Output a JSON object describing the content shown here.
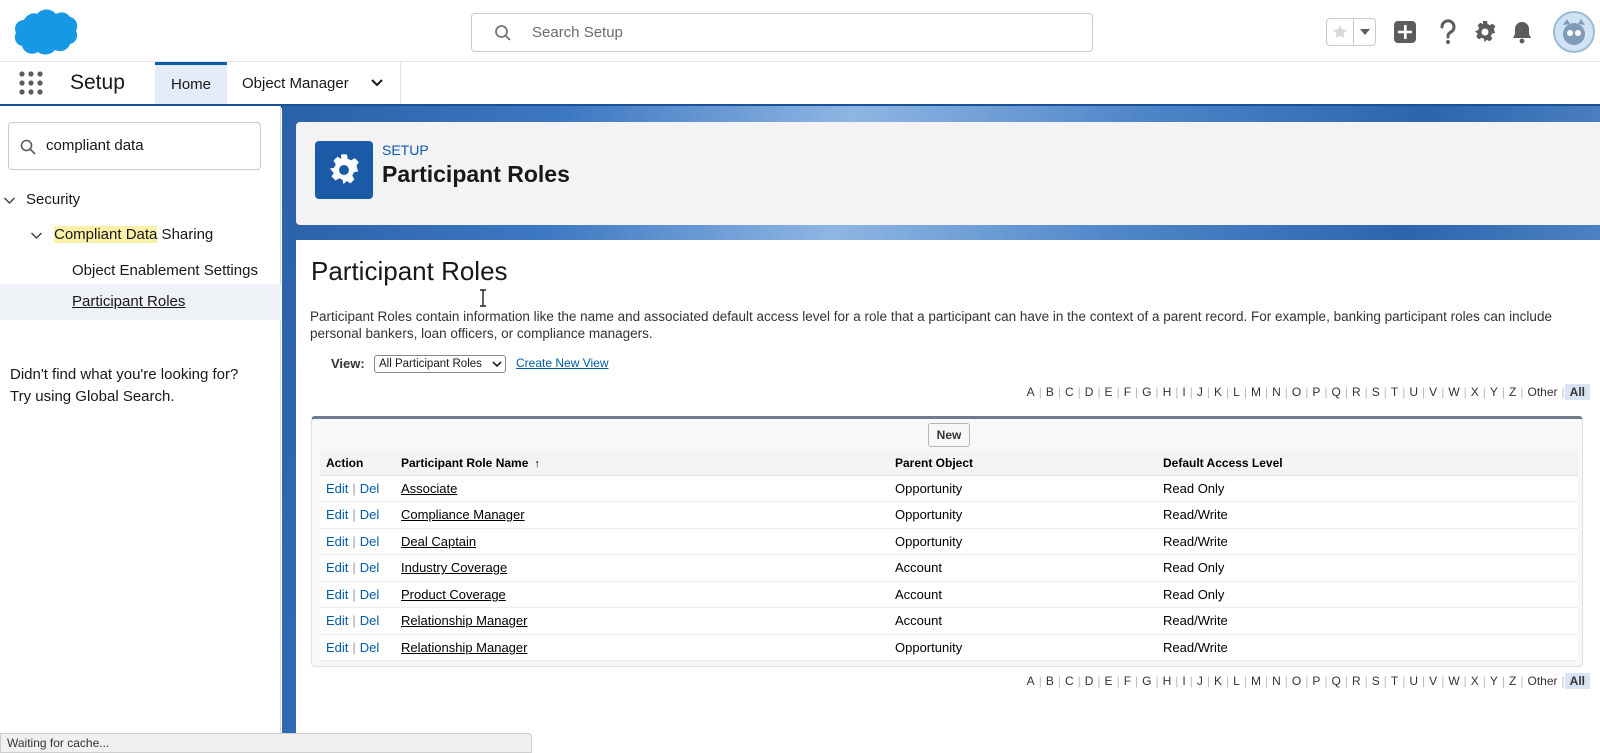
{
  "header": {
    "search_placeholder": "Search Setup",
    "icons": [
      "salesforce-cloud-logo",
      "search-icon",
      "favorite-star-icon",
      "favorites-dropdown-icon",
      "add-icon",
      "help-icon",
      "gear-icon",
      "notification-bell-icon",
      "avatar"
    ]
  },
  "nav": {
    "app_name": "Setup",
    "tabs": [
      {
        "label": "Home",
        "active": true
      },
      {
        "label": "Object Manager",
        "active": false
      }
    ]
  },
  "sidebar": {
    "quickfind_value": "compliant data",
    "tree": {
      "level1": "Security",
      "level2_highlight": "Compliant Data",
      "level2_rest": " Sharing",
      "items": [
        "Object Enablement Settings",
        "Participant Roles"
      ]
    },
    "no_find_line1": "Didn't find what you're looking for?",
    "no_find_line2": "Try using Global Search."
  },
  "page_header": {
    "eyebrow": "SETUP",
    "title": "Participant Roles"
  },
  "content": {
    "title": "Participant Roles",
    "description": "Participant Roles contain information like the name and associated default access level for a role that a participant can have in the context of a parent record. For example, banking participant roles can include personal bankers, loan officers, or compliance managers.",
    "view_label": "View:",
    "view_selected": "All Participant Roles",
    "create_view": "Create New View",
    "alphabet": [
      "A",
      "B",
      "C",
      "D",
      "E",
      "F",
      "G",
      "H",
      "I",
      "J",
      "K",
      "L",
      "M",
      "N",
      "O",
      "P",
      "Q",
      "R",
      "S",
      "T",
      "U",
      "V",
      "W",
      "X",
      "Y",
      "Z",
      "Other",
      "All"
    ],
    "new_button": "New",
    "columns": [
      "Action",
      "Participant Role Name",
      "Parent Object",
      "Default Access Level"
    ],
    "sort_indicator": "↑",
    "edit_label": "Edit",
    "del_label": "Del",
    "rows": [
      {
        "name": "Associate",
        "parent": "Opportunity",
        "access": "Read Only"
      },
      {
        "name": "Compliance Manager",
        "parent": "Opportunity",
        "access": "Read/Write"
      },
      {
        "name": "Deal Captain",
        "parent": "Opportunity",
        "access": "Read/Write"
      },
      {
        "name": "Industry Coverage",
        "parent": "Account",
        "access": "Read Only"
      },
      {
        "name": "Product Coverage",
        "parent": "Account",
        "access": "Read Only"
      },
      {
        "name": "Relationship Manager",
        "parent": "Account",
        "access": "Read/Write"
      },
      {
        "name": "Relationship Manager",
        "parent": "Opportunity",
        "access": "Read/Write"
      }
    ]
  },
  "status_bar": "Waiting for cache...",
  "colors": {
    "brand_blue": "#0b5cab",
    "cloud_blue": "#1798e5",
    "highlight_yellow": "#fbf0a8",
    "page_icon_blue": "#1b5aa6"
  }
}
